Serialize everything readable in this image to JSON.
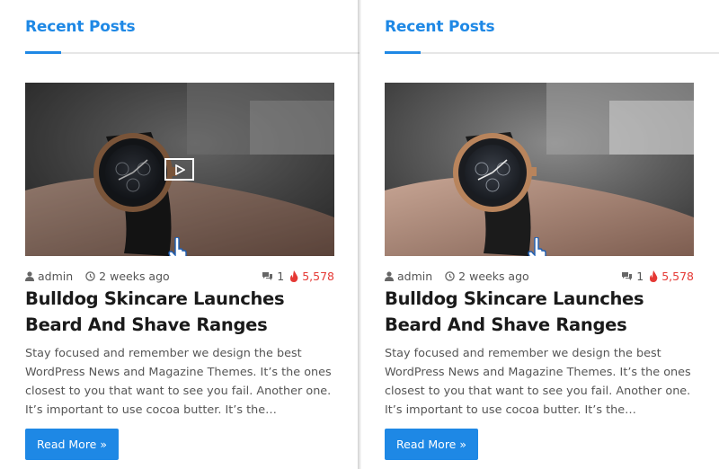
{
  "widget": {
    "title": "Recent Posts"
  },
  "post": {
    "author": "admin",
    "date": "2 weeks ago",
    "comments": "1",
    "views": "5,578",
    "title": "Bulldog Skincare Launches Beard And Shave Ranges",
    "excerpt": "Stay focused and remember we design the best WordPress News and Magazine Themes. It’s the ones closest to you that want to see you fail. Another one. It’s important to use cocoa butter. It’s the…",
    "read_more": "Read More »"
  },
  "colors": {
    "accent": "#1e88e5",
    "views": "#e53935"
  },
  "icons": [
    "user-icon",
    "clock-icon",
    "comment-icon",
    "fire-icon",
    "play-icon",
    "hand-cursor-icon"
  ]
}
